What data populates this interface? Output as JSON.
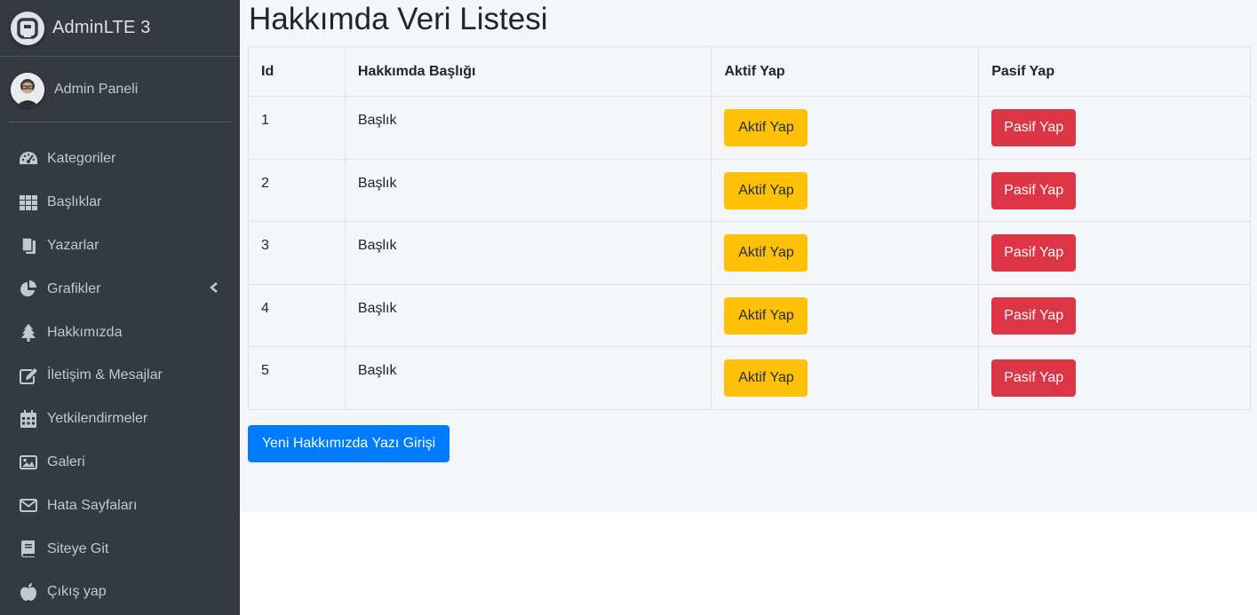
{
  "brand": {
    "title": "AdminLTE 3",
    "icon": "adminlte-logo-icon"
  },
  "user": {
    "name": "Admin Paneli",
    "icon": "user-avatar-icon"
  },
  "sidebar": {
    "items": [
      {
        "label": "Kategoriler",
        "icon": "tachometer-icon"
      },
      {
        "label": "Başlıklar",
        "icon": "grid-icon"
      },
      {
        "label": "Yazarlar",
        "icon": "copy-icon"
      },
      {
        "label": "Grafikler",
        "icon": "pie-chart-icon",
        "expandable": true
      },
      {
        "label": "Hakkımızda",
        "icon": "tree-icon"
      },
      {
        "label": "İletişim & Mesajlar",
        "icon": "edit-icon"
      },
      {
        "label": "Yetkilendirmeler",
        "icon": "calendar-icon"
      },
      {
        "label": "Galeri",
        "icon": "image-icon"
      },
      {
        "label": "Hata Sayfaları",
        "icon": "envelope-icon"
      },
      {
        "label": "Siteye Git",
        "icon": "book-icon"
      },
      {
        "label": "Çıkış yap",
        "icon": "apple-icon"
      }
    ]
  },
  "page": {
    "title": "Hakkımda Veri Listesi"
  },
  "table": {
    "headers": [
      "Id",
      "Hakkımda Başlığı",
      "Aktif Yap",
      "Pasif Yap"
    ],
    "rows": [
      {
        "id": "1",
        "title": "Başlık",
        "activate": "Aktif Yap",
        "deactivate": "Pasif Yap"
      },
      {
        "id": "2",
        "title": "Başlık",
        "activate": "Aktif Yap",
        "deactivate": "Pasif Yap"
      },
      {
        "id": "3",
        "title": "Başlık",
        "activate": "Aktif Yap",
        "deactivate": "Pasif Yap"
      },
      {
        "id": "4",
        "title": "Başlık",
        "activate": "Aktif Yap",
        "deactivate": "Pasif Yap"
      },
      {
        "id": "5",
        "title": "Başlık",
        "activate": "Aktif Yap",
        "deactivate": "Pasif Yap"
      }
    ]
  },
  "actions": {
    "new_entry_label": "Yeni Hakkımızda Yazı Girişi"
  },
  "colors": {
    "sidebar_bg": "#343a40",
    "content_bg": "#f4f6f9",
    "warning": "#ffc107",
    "danger": "#dc3545",
    "primary": "#007bff"
  }
}
